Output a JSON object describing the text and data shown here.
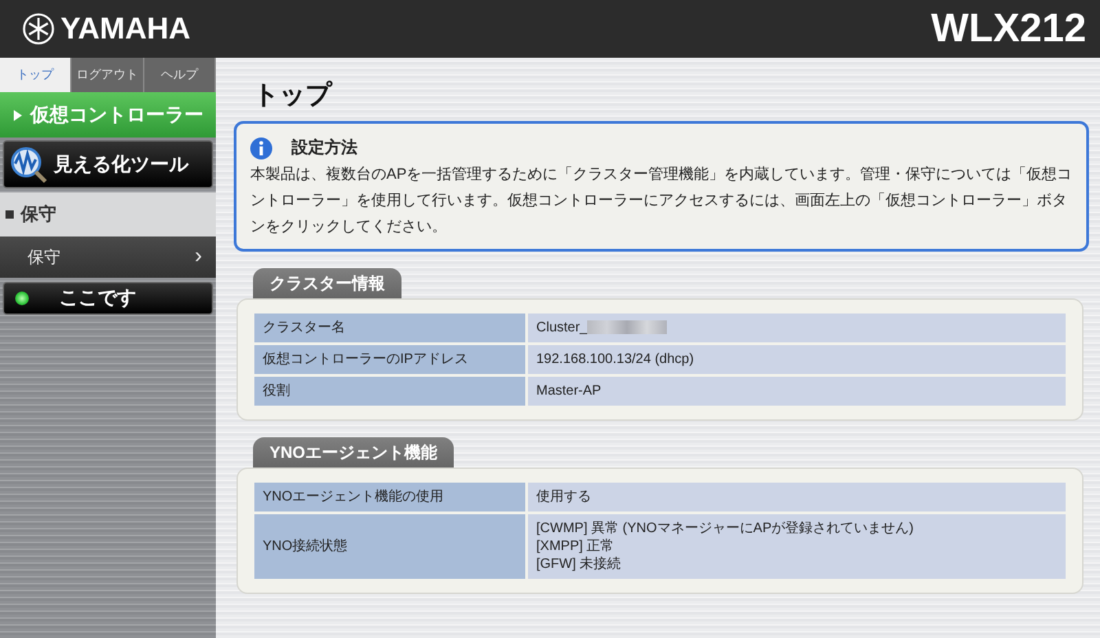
{
  "header": {
    "logo": "YAMAHA",
    "model": "WLX212"
  },
  "sidebar": {
    "tabs": [
      {
        "label": "トップ",
        "selected": true
      },
      {
        "label": "ログアウト",
        "selected": false
      },
      {
        "label": "ヘルプ",
        "selected": false
      }
    ],
    "controller_button": "仮想コントローラー",
    "tool_button": "見える化ツール",
    "section_title": "保守",
    "items": [
      {
        "label": "保守",
        "arrow": "›"
      }
    ],
    "here_button": "ここです"
  },
  "main": {
    "title": "トップ",
    "notice": {
      "title": "設定方法",
      "text": "本製品は、複数台のAPを一括管理するために「クラスター管理機能」を内蔵しています。管理・保守については「仮想コントローラー」を使用して行います。仮想コントローラーにアクセスするには、画面左上の「仮想コントローラー」ボタンをクリックしてください。"
    },
    "sections": [
      {
        "title": "クラスター情報",
        "rows": [
          {
            "label": "クラスター名",
            "value": [
              "Cluster_"
            ],
            "redacted": true
          },
          {
            "label": "仮想コントローラーのIPアドレス",
            "value": [
              "192.168.100.13/24 (dhcp)"
            ],
            "redacted": false
          },
          {
            "label": "役割",
            "value": [
              "Master-AP"
            ],
            "redacted": false
          }
        ]
      },
      {
        "title": "YNOエージェント機能",
        "rows": [
          {
            "label": "YNOエージェント機能の使用",
            "value": [
              "使用する"
            ],
            "redacted": false
          },
          {
            "label": "YNO接続状態",
            "value": [
              "[CWMP] 異常 (YNOマネージャーにAPが登録されていません)",
              "[XMPP] 正常",
              "[GFW] 未接続"
            ],
            "redacted": false
          }
        ]
      }
    ]
  }
}
